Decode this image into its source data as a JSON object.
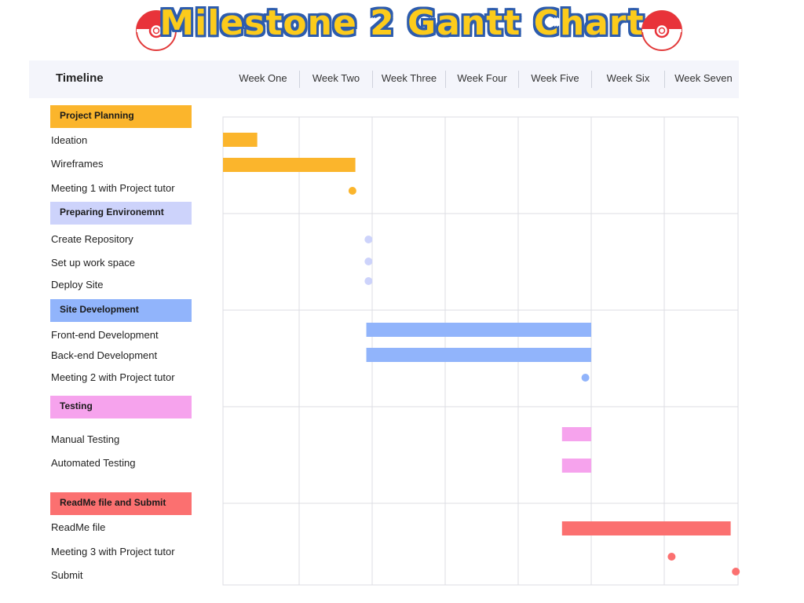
{
  "title": "Milestone 2 Gantt Chart",
  "timeline_label": "Timeline",
  "weeks": [
    "Week One",
    "Week Two",
    "Week Three",
    "Week Four",
    "Week Five",
    "Week Six",
    "Week Seven"
  ],
  "icons": {
    "title_left": "pokeball-icon",
    "title_right": "pokeball-icon"
  },
  "colors": {
    "title_fill": "#fccb1b",
    "title_outline": "#2d5cad"
  },
  "chart_data": {
    "type": "gantt",
    "x_unit": "weeks",
    "xlim": [
      0,
      7
    ],
    "grid": true,
    "phases": [
      {
        "name": "Project Planning",
        "color": "#fbb52c",
        "tasks": [
          {
            "name": "Ideation",
            "kind": "bar",
            "start": 0.0,
            "end": 0.45
          },
          {
            "name": "Wireframes",
            "kind": "bar",
            "start": 0.0,
            "end": 1.77
          },
          {
            "name": "Meeting 1 with Project tutor",
            "kind": "milestone",
            "at": 1.73
          }
        ]
      },
      {
        "name": "Preparing Environemnt",
        "color": "#cdd3fb",
        "tasks": [
          {
            "name": "Create Repository",
            "kind": "milestone",
            "at": 1.95
          },
          {
            "name": "Set up work space",
            "kind": "milestone",
            "at": 1.95
          },
          {
            "name": "Deploy Site",
            "kind": "milestone",
            "at": 1.95
          }
        ]
      },
      {
        "name": "Site Development",
        "color": "#91b4fb",
        "tasks": [
          {
            "name": "Front-end Development",
            "kind": "bar",
            "start": 1.92,
            "end": 5.0
          },
          {
            "name": "Back-end Development",
            "kind": "bar",
            "start": 1.92,
            "end": 5.0
          },
          {
            "name": "Meeting 2 with Project tutor",
            "kind": "milestone",
            "at": 4.92
          }
        ]
      },
      {
        "name": "Testing",
        "color": "#f6a3ed",
        "tasks": [
          {
            "name": "Manual Testing",
            "kind": "bar",
            "start": 4.6,
            "end": 5.0
          },
          {
            "name": "Automated Testing",
            "kind": "bar",
            "start": 4.6,
            "end": 5.0
          }
        ]
      },
      {
        "name": "ReadMe file and Submit",
        "color": "#fb7070",
        "tasks": [
          {
            "name": "ReadMe file",
            "kind": "bar",
            "start": 4.6,
            "end": 6.9
          },
          {
            "name": "Meeting 3 with Project tutor",
            "kind": "milestone",
            "at": 6.1
          },
          {
            "name": "Submit",
            "kind": "milestone",
            "at": 6.97
          }
        ]
      }
    ]
  }
}
